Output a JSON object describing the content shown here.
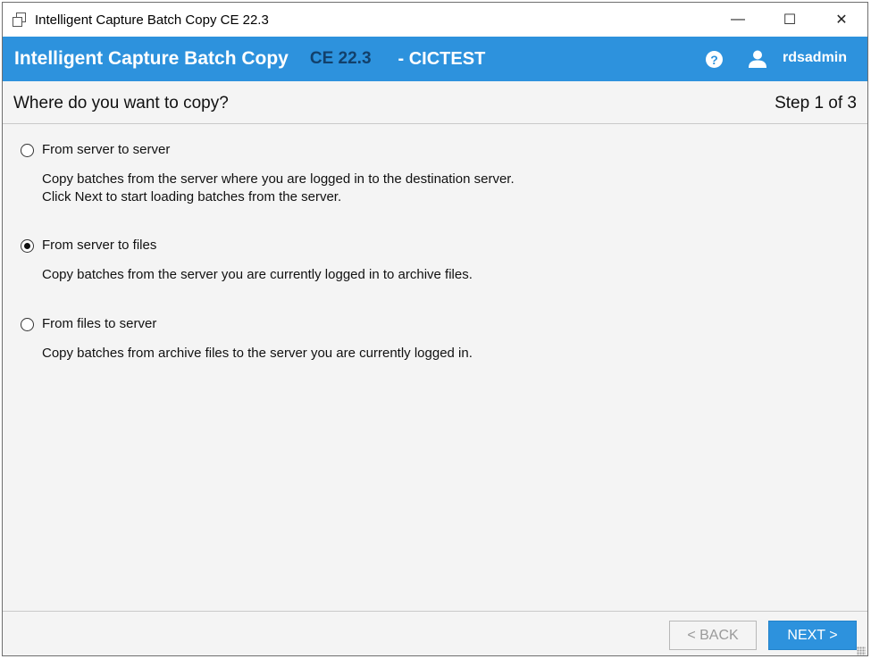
{
  "window": {
    "title": "Intelligent Capture Batch Copy CE 22.3",
    "minimize_glyph": "—",
    "maximize_glyph": "☐",
    "close_glyph": "✕"
  },
  "header": {
    "product": "Intelligent Capture Batch Copy",
    "version": "CE 22.3",
    "server": "- CICTEST",
    "help_glyph": "?",
    "username": "rdsadmin"
  },
  "step": {
    "question": "Where do you want to copy?",
    "indicator": "Step 1 of 3"
  },
  "options": [
    {
      "label": "From server to server",
      "checked": false,
      "desc_line1": "Copy batches from the server where you are logged in to the destination server.",
      "desc_line2": "Click Next to start loading batches from the server."
    },
    {
      "label": "From server to files",
      "checked": true,
      "desc_line1": "Copy batches from the server you are currently logged in to archive files."
    },
    {
      "label": "From files to server",
      "checked": false,
      "desc_line1": "Copy batches from archive files to the server you are currently logged in."
    }
  ],
  "footer": {
    "back_label": "< BACK",
    "next_label": "NEXT >"
  },
  "colors": {
    "accent": "#2d92dd",
    "version_text": "#12406b",
    "background": "#f4f4f4"
  },
  "icons": {
    "app": "app-window-icon",
    "help": "help-icon",
    "user": "user-icon"
  }
}
